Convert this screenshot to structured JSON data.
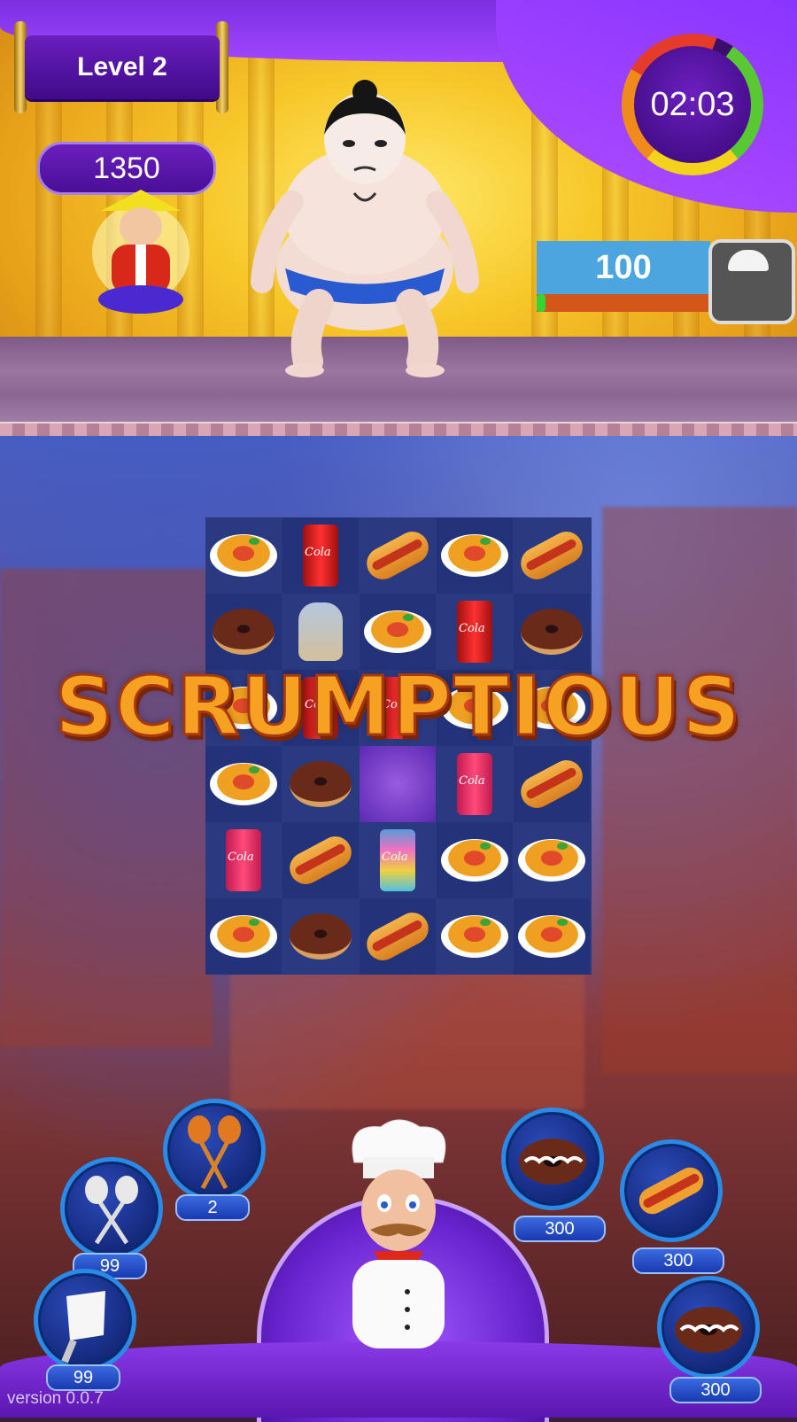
{
  "hud": {
    "level_label": "Level 2",
    "score": "1350",
    "timer": "02:03",
    "weight_value": "100",
    "weight_progress": 0.05
  },
  "combo_text": "SCRUMPTIOUS",
  "board": {
    "rows": 6,
    "cols": 5,
    "cells": [
      [
        "spaghetti",
        "cola-can",
        "hotdog",
        "spaghetti",
        "hotdog"
      ],
      [
        "donut",
        "bread-bag",
        "spaghetti",
        "cola-can",
        "donut"
      ],
      [
        "spaghetti",
        "cola-can",
        "cola-can",
        "spaghetti",
        "spaghetti"
      ],
      [
        "spaghetti",
        "donut",
        "empty",
        "pink-cola-can",
        "hotdog"
      ],
      [
        "pink-cola-can",
        "hotdog",
        "rainbow-can",
        "spaghetti",
        "spaghetti"
      ],
      [
        "spaghetti",
        "donut",
        "hotdog",
        "spaghetti",
        "spaghetti"
      ]
    ]
  },
  "boosters": [
    {
      "name": "silver-spoons",
      "count": "99"
    },
    {
      "name": "wooden-spoons",
      "count": "2"
    },
    {
      "name": "cleaver",
      "count": "99"
    }
  ],
  "orders": [
    {
      "name": "donut",
      "count": "300"
    },
    {
      "name": "hotdog",
      "count": "300"
    },
    {
      "name": "donut",
      "count": "300"
    }
  ],
  "footer": {
    "version": "version 0.0.7"
  }
}
